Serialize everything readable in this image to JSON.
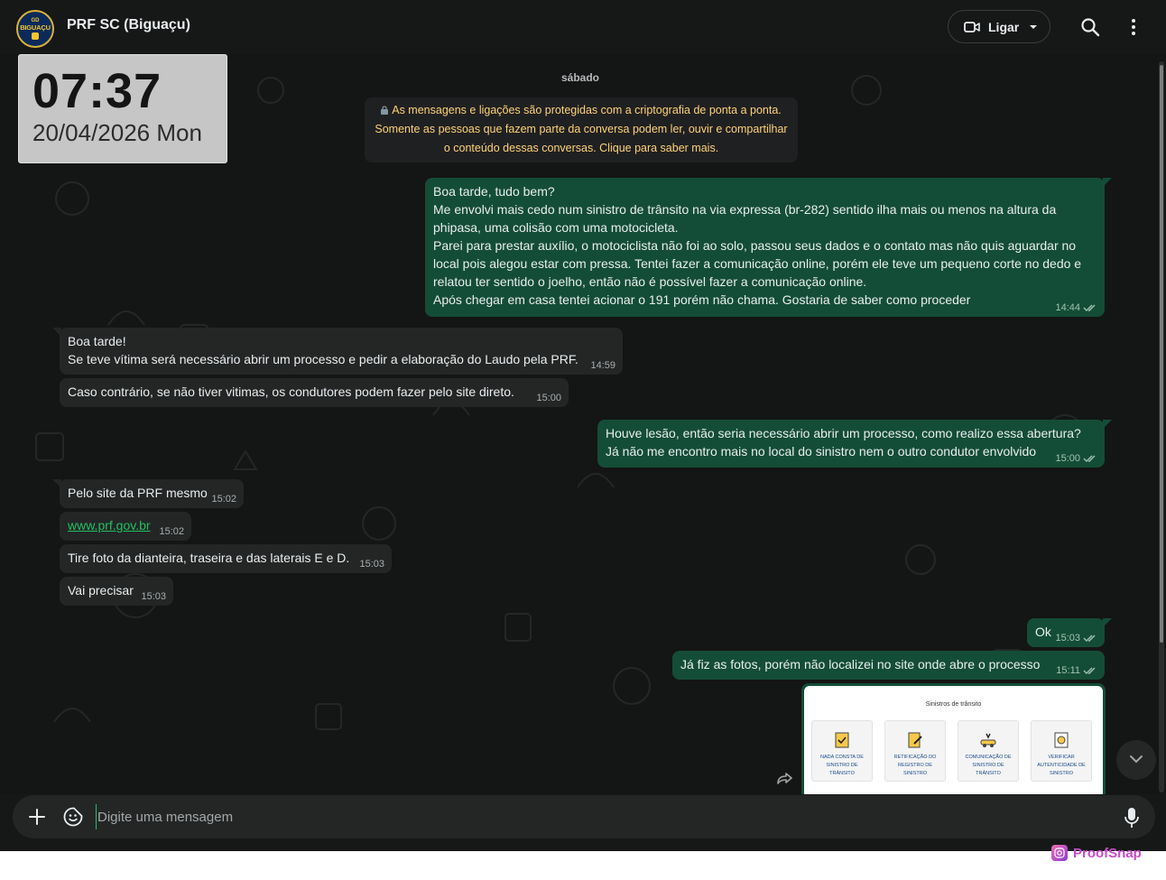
{
  "header": {
    "avatar_text_top": "GD",
    "avatar_text_main": "BIGUAÇU",
    "title": "PRF SC (Biguaçu)",
    "call_label": "Ligar"
  },
  "clock": {
    "time": "07:37",
    "date": "20/04/2026 Mon"
  },
  "chat": {
    "day_label": "sábado",
    "encryption_notice": "As mensagens e ligações são protegidas com a criptografia de ponta a ponta.\nSomente as pessoas que fazem parte da conversa podem ler, ouvir e compartilhar\no conteúdo dessas conversas. Clique para saber mais.",
    "messages": [
      {
        "direction": "out",
        "text": "Boa tarde, tudo bem?\nMe envolvi mais cedo num sinistro de trânsito na via expressa (br-282) sentido ilha mais ou menos na altura da\nphipasa, uma colisão com uma motocicleta.\nParei para prestar auxílio, o motociclista não foi ao solo, passou seus dados e o contato mas não quis aguardar no\nlocal pois alegou estar com pressa. Tentei fazer a comunicação online, porém ele teve um pequeno corte no dedo e\nrelatou ter sentido o joelho, então não é possível fazer a comunicação online.\nApós chegar em casa tentei acionar o 191 porém não chama. Gostaria de saber como proceder",
        "time": "14:44"
      },
      {
        "direction": "in",
        "text": "Boa tarde!\nSe teve vítima será necessário abrir um processo e pedir a elaboração do Laudo pela  PRF.",
        "time": "14:59"
      },
      {
        "direction": "in",
        "text": "Caso contrário,  se não tiver vitimas,  os condutores podem fazer pelo site direto.",
        "time": "15:00"
      },
      {
        "direction": "out",
        "text": "Houve lesão, então seria necessário abrir um processo, como realizo essa abertura?\nJá não me encontro mais no local do sinistro nem o outro condutor envolvido",
        "time": "15:00"
      },
      {
        "direction": "in",
        "text": "Pelo site da PRF mesmo",
        "time": "15:02"
      },
      {
        "direction": "in",
        "text": "www.prf.gov.br",
        "time": "15:02",
        "is_link": true
      },
      {
        "direction": "in",
        "text": "Tire foto da dianteira,  traseira e das laterais E e D.",
        "time": "15:03"
      },
      {
        "direction": "in",
        "text": "Vai precisar",
        "time": "15:03"
      },
      {
        "direction": "out",
        "text": "Ok",
        "time": "15:03"
      },
      {
        "direction": "out",
        "text": "Já fiz as fotos, porém não localizei no site onde abre o processo",
        "time": "15:11"
      }
    ],
    "image_attachment": {
      "title": "Sinistros de trânsito",
      "cards": [
        "NADA CONSTA DE SINISTRO DE TRÂNSITO",
        "RETIFICAÇÃO DO REGISTRO DE SINISTRO",
        "COMUNICAÇÃO DE SINISTRO DE TRÂNSITO",
        "VERIFICAR AUTENTICIDADE DE SINISTRO"
      ]
    }
  },
  "composer": {
    "placeholder": "Digite uma mensagem"
  },
  "watermark": {
    "text": "ProofSnap"
  },
  "colors": {
    "background": "#161717",
    "incoming_bubble": "#242626",
    "outgoing_bubble": "#144d37",
    "accent": "#21c063",
    "notice_text": "#ffd279"
  }
}
